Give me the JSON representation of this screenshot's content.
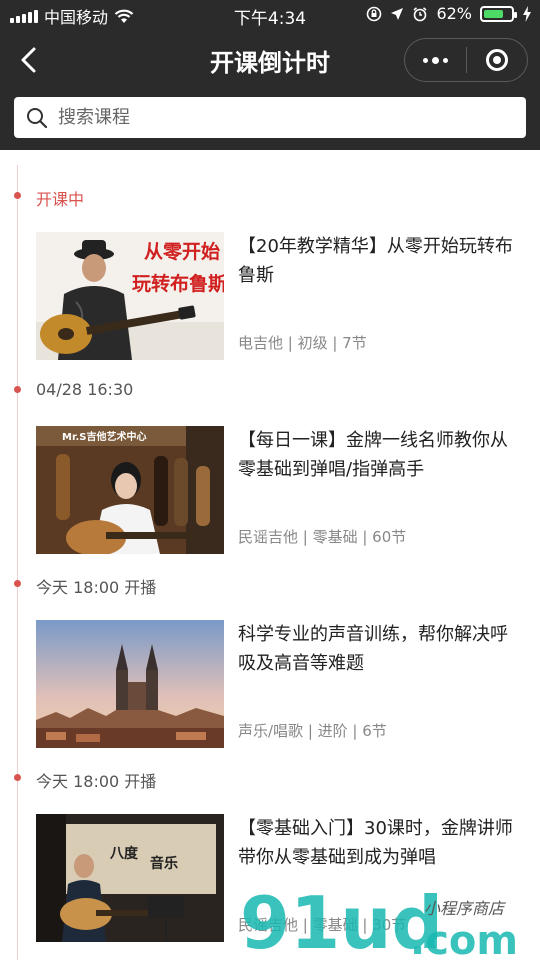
{
  "status_bar": {
    "carrier": "中国移动",
    "time": "下午4:34",
    "battery": "62%"
  },
  "nav": {
    "title": "开课倒计时"
  },
  "search": {
    "placeholder": "搜索课程"
  },
  "sections": [
    {
      "label": "开课中",
      "course": {
        "title": "【20年教学精华】从零开始玩转布鲁斯",
        "meta": "电吉他 | 初级 | 7节",
        "thumb_text_1": "从零开始",
        "thumb_text_2": "玩转布鲁斯"
      }
    },
    {
      "label": "04/28 16:30",
      "course": {
        "title": "【每日一课】金牌一线名师教你从零基础到弹唱/指弹高手",
        "meta": "民谣吉他 | 零基础 | 60节",
        "thumb_text_1": "Mr.S吉他艺术中心"
      }
    },
    {
      "label": "今天 18:00 开播",
      "course": {
        "title": "科学专业的声音训练，帮你解决呼吸及高音等难题",
        "meta": "声乐/唱歌 | 进阶 | 6节"
      }
    },
    {
      "label": "今天 18:00 开播",
      "course": {
        "title": "【零基础入门】30课时，金牌讲师带你从零基础到成为弹唱",
        "meta": "民谣吉他 | 零基础 | 30节",
        "thumb_text_1": "八度",
        "thumb_text_2": "音乐"
      }
    }
  ],
  "watermark": {
    "brand": "91ud",
    "domain": ".com",
    "tagline": "小程序商店"
  },
  "colors": {
    "header_bg": "#2b2b2b",
    "accent_red": "#d9534f",
    "battery_green": "#4cd964"
  }
}
